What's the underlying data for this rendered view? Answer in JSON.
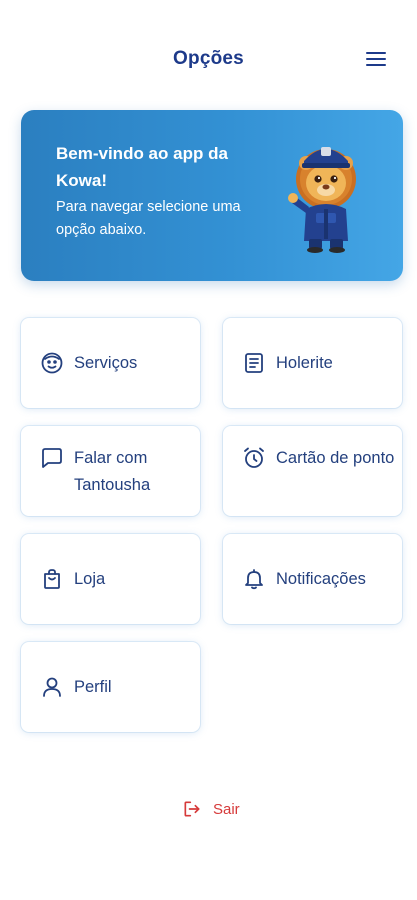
{
  "header": {
    "title": "Opções"
  },
  "banner": {
    "title": "Bem-vindo ao app da Kowa!",
    "subtitle": "Para navegar selecione uma opção abaixo."
  },
  "options": [
    {
      "label": "Serviços",
      "icon": "smiley-face-icon"
    },
    {
      "label": "Holerite",
      "icon": "document-icon"
    },
    {
      "label": "Falar com Tantousha",
      "icon": "chat-bubble-icon"
    },
    {
      "label": "Cartão de ponto",
      "icon": "alarm-clock-icon"
    },
    {
      "label": "Loja",
      "icon": "shopping-bag-icon"
    },
    {
      "label": "Notificações",
      "icon": "bell-icon"
    },
    {
      "label": "Perfil",
      "icon": "user-icon"
    }
  ],
  "logout": {
    "label": "Sair",
    "icon": "logout-icon"
  },
  "colors": {
    "primary": "#1d3a8a",
    "text": "#24407e",
    "banner_start": "#2b7fc0",
    "banner_end": "#44a6e6",
    "danger": "#d63a3a"
  }
}
